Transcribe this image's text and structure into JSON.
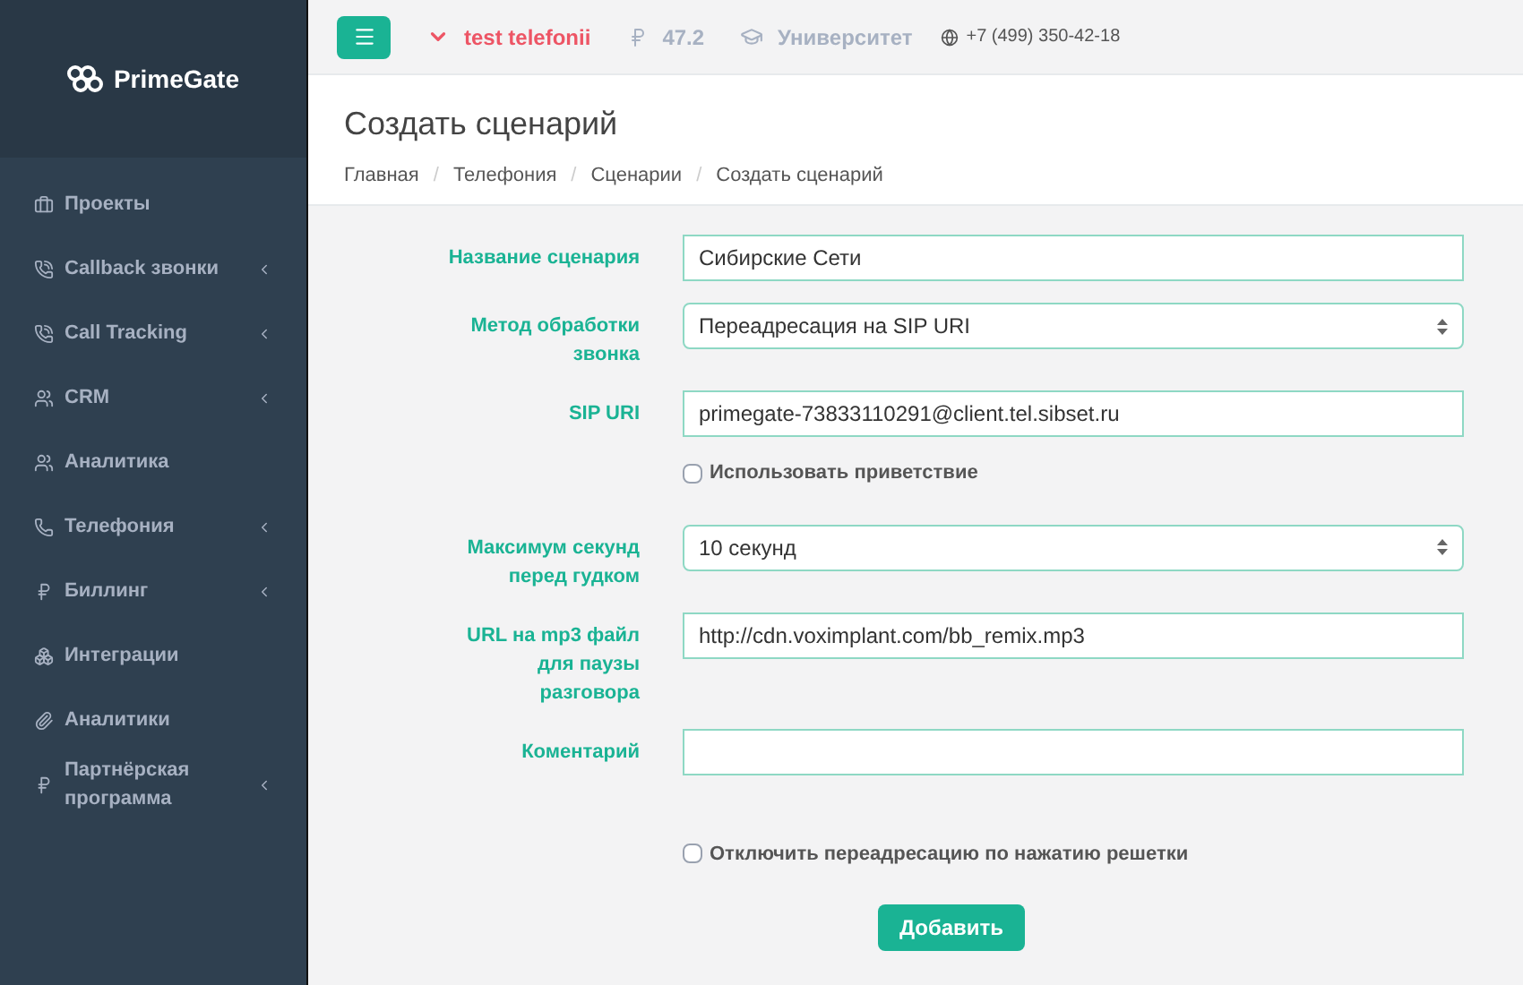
{
  "brand": "PrimeGate",
  "sidebar": {
    "items": [
      {
        "label": "Проекты",
        "expandable": false
      },
      {
        "label": "Callback звонки",
        "expandable": true
      },
      {
        "label": "Call Tracking",
        "expandable": true
      },
      {
        "label": "CRM",
        "expandable": true
      },
      {
        "label": "Аналитика",
        "expandable": false
      },
      {
        "label": "Телефония",
        "expandable": true
      },
      {
        "label": "Биллинг",
        "expandable": true
      },
      {
        "label": "Интеграции",
        "expandable": false
      },
      {
        "label": "Аналитики",
        "expandable": false
      },
      {
        "label": "Партнёрская программа",
        "expandable": true
      }
    ]
  },
  "topbar": {
    "account": "test telefonii",
    "balance": "47.2",
    "university": "Университет",
    "phone": "+7 (499) 350-42-18"
  },
  "page": {
    "title": "Создать сценарий",
    "breadcrumbs": [
      "Главная",
      "Телефония",
      "Сценарии",
      "Создать сценарий"
    ],
    "breadcrumb_separator": "/"
  },
  "form": {
    "fields": [
      {
        "kind": "input",
        "label": "Название сценария",
        "value": "Сибирские Сети"
      },
      {
        "kind": "select",
        "label": "Метод обработки звонка",
        "value": "Переадресация на SIP URI"
      },
      {
        "kind": "input",
        "label": "SIP URI",
        "value": "primegate-73833110291@client.tel.sibset.ru"
      },
      {
        "kind": "checkbox",
        "label": "Использовать приветствие",
        "checked": false
      },
      {
        "kind": "select",
        "label": "Максимум секунд перед гудком",
        "value": "10 секунд"
      },
      {
        "kind": "input",
        "label": "URL на mp3 файл для паузы разговора",
        "value": "http://cdn.voximplant.com/bb_remix.mp3"
      },
      {
        "kind": "input",
        "label": "Коментарий"
      },
      {
        "kind": "checkbox",
        "label": "Отключить переадресацию по нажатию решетки",
        "checked": false
      }
    ],
    "submit": "Добавить"
  }
}
